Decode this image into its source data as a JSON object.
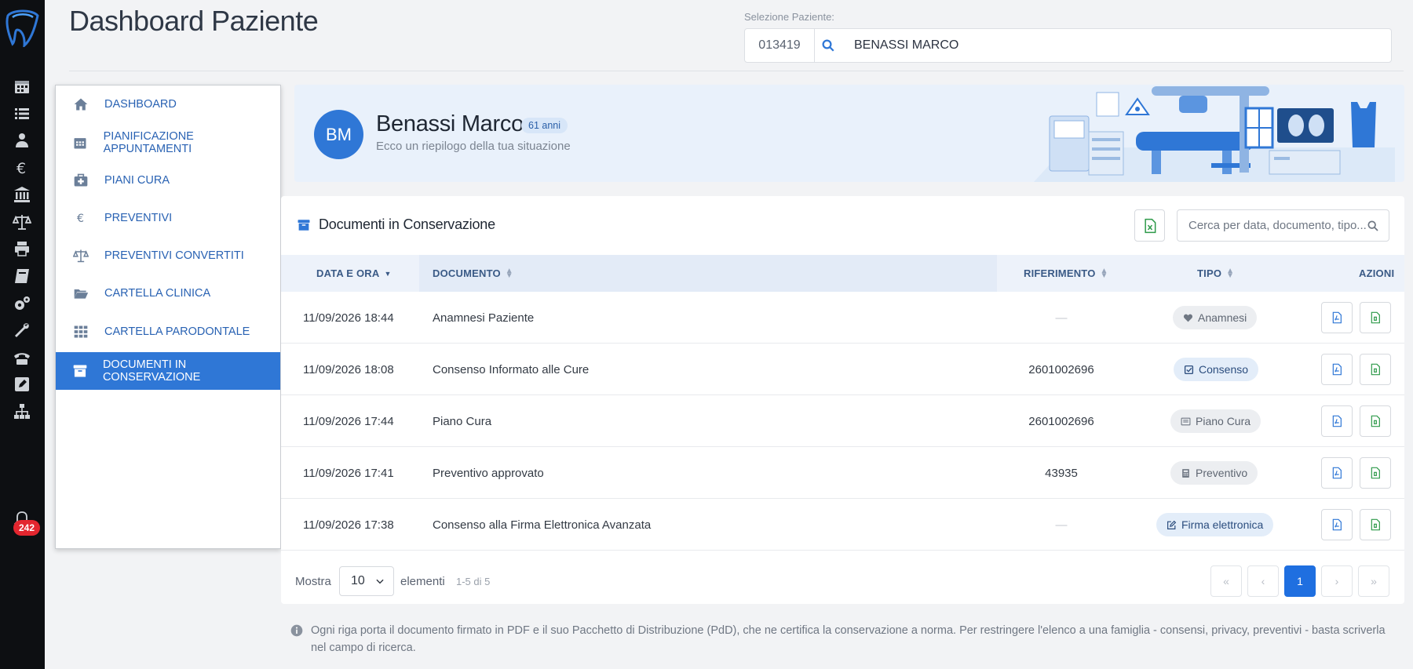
{
  "page": {
    "title": "Dashboard Paziente"
  },
  "patient_selector": {
    "label": "Selezione Paziente:",
    "code": "013419",
    "name": "BENASSI MARCO"
  },
  "rail": {
    "items": [
      "calendar-icon",
      "list-icon",
      "doctor-icon",
      "euro-icon",
      "bank-icon",
      "scale-icon",
      "printer-icon",
      "book-icon",
      "gears-icon",
      "wrench-icon",
      "phone-icon",
      "edit-icon",
      "sitemap-icon",
      "bell-icon"
    ],
    "notifications": "242"
  },
  "menu": {
    "items": [
      {
        "label": "DASHBOARD",
        "icon": "home-icon"
      },
      {
        "label": "PIANIFICAZIONE APPUNTAMENTI",
        "icon": "calendar-icon"
      },
      {
        "label": "PIANI CURA",
        "icon": "medkit-icon"
      },
      {
        "label": "PREVENTIVI",
        "icon": "euro-icon"
      },
      {
        "label": "PREVENTIVI CONVERTITI",
        "icon": "scale-icon"
      },
      {
        "label": "CARTELLA CLINICA",
        "icon": "folder-open-icon"
      },
      {
        "label": "CARTELLA PARODONTALE",
        "icon": "grid-icon"
      },
      {
        "label": "DOCUMENTI IN CONSERVAZIONE",
        "icon": "archive-icon",
        "active": true
      }
    ]
  },
  "banner": {
    "initials": "BM",
    "name": "Benassi Marco",
    "age": "61 anni",
    "subtitle": "Ecco un riepilogo della tua situazione"
  },
  "documents": {
    "title": "Documenti in Conservazione",
    "search_placeholder": "Cerca per data, documento, tipo...",
    "columns": {
      "date": "DATA E ORA",
      "document": "DOCUMENTO",
      "reference": "RIFERIMENTO",
      "type": "TIPO",
      "actions": "AZIONI"
    },
    "rows": [
      {
        "date": "11/09/2026 18:44",
        "document": "Anamnesi Paziente",
        "reference": "—",
        "type": "Anamnesi",
        "type_icon": "heartbeat-icon"
      },
      {
        "date": "11/09/2026 18:08",
        "document": "Consenso Informato alle Cure",
        "reference": "2601002696",
        "type": "Consenso",
        "type_icon": "check-square-icon"
      },
      {
        "date": "11/09/2026 17:44",
        "document": "Piano Cura",
        "reference": "2601002696",
        "type": "Piano Cura",
        "type_icon": "list-alt-icon"
      },
      {
        "date": "11/09/2026 17:41",
        "document": "Preventivo approvato",
        "reference": "43935",
        "type": "Preventivo",
        "type_icon": "calculator-icon"
      },
      {
        "date": "11/09/2026 17:38",
        "document": "Consenso alla Firma Elettronica Avanzata",
        "reference": "—",
        "type": "Firma elettronica",
        "type_icon": "edit-icon"
      }
    ],
    "footer": {
      "show_label": "Mostra",
      "page_size": "10",
      "items_label": "elementi",
      "count": "1-5 di 5"
    },
    "pagination": {
      "first": "«",
      "prev": "‹",
      "current": "1",
      "next": "›",
      "last": "»"
    }
  },
  "info_note": "Ogni riga porta il documento firmato in PDF e il suo Pacchetto di Distribuzione (PdD), che ne certifica la conservazione a norma. Per restringere l'elenco a una famiglia - consensi, privacy, preventivi - basta scriverla nel campo di ricerca.",
  "colors": {
    "accent": "#2f77d6",
    "rail": "#0d0f12",
    "badge": "#e3262f",
    "excel": "#2e9a4a"
  }
}
